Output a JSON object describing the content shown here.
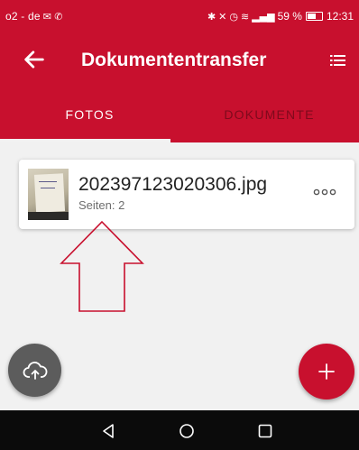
{
  "status_bar": {
    "carrier": "o2 - de",
    "battery": "59 %",
    "battery_level": 0.59,
    "time": "12:31"
  },
  "app_bar": {
    "title": "Dokumententransfer"
  },
  "tabs": [
    {
      "label": "FOTOS",
      "selected": true
    },
    {
      "label": "DOKUMENTE",
      "selected": false
    }
  ],
  "files": [
    {
      "name": "202397123020306.jpg",
      "pages": "Seiten: 2"
    }
  ],
  "colors": {
    "primary": "#c8102e",
    "tab_inactive": "#7e0a1c",
    "upload_fab": "#5c5c5c",
    "annotation": "#c8102e"
  },
  "icons": {
    "back": "arrow-left-icon",
    "menu": "list-icon",
    "more": "more-horizontal-icon",
    "upload": "cloud-upload-icon",
    "add": "plus-icon"
  }
}
